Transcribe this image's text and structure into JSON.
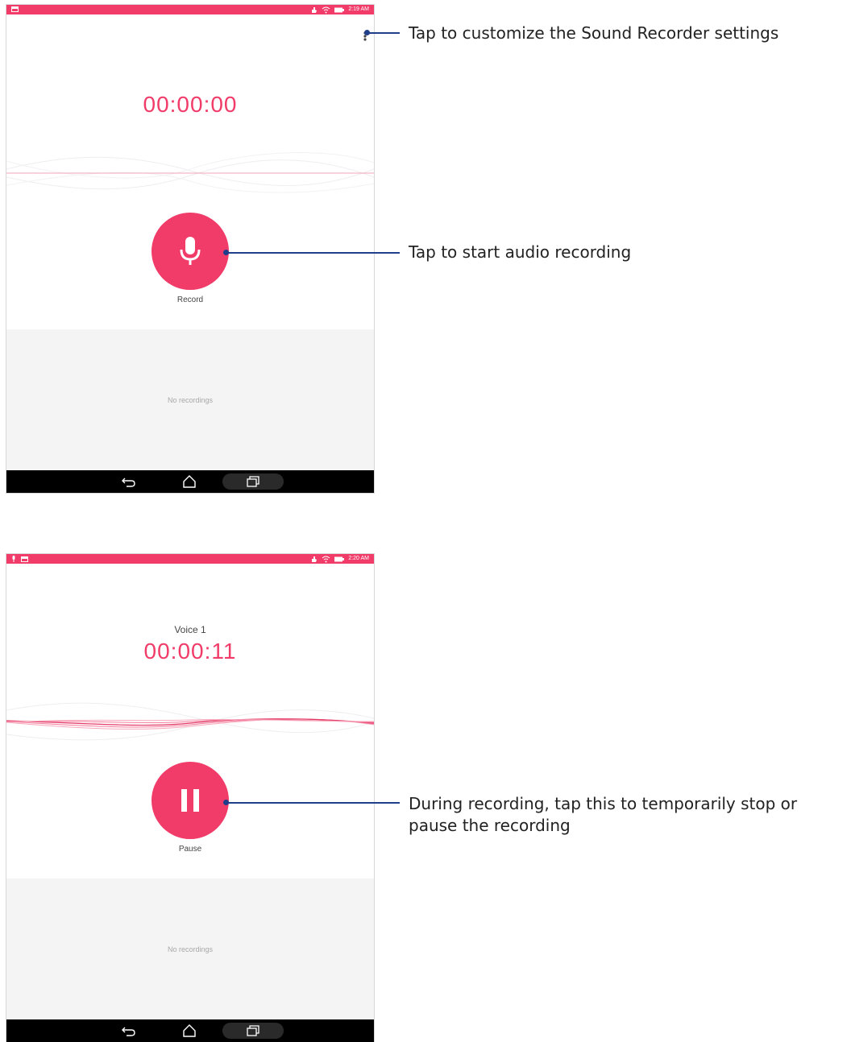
{
  "screen1": {
    "status_time": "2:19 AM",
    "timer": "00:00:00",
    "action_label": "Record",
    "empty_text": "No recordings"
  },
  "screen2": {
    "status_time": "2:20 AM",
    "recording_name": "Voice 1",
    "timer": "00:00:11",
    "action_label": "Pause",
    "empty_text": "No recordings"
  },
  "callouts": {
    "settings": "Tap to customize the Sound Recorder settings",
    "record": "Tap to start audio recording",
    "pause": "During recording, tap this to temporarily stop or pause the recording"
  },
  "icons": {
    "settings": "overflow-menu-icon",
    "record": "microphone-icon",
    "pause": "pause-icon",
    "back": "back-icon",
    "home": "home-icon",
    "recent": "recent-apps-icon"
  },
  "colors": {
    "accent": "#f13c6a",
    "callout": "#1f3f8a",
    "empty_area": "#f4f4f4",
    "navbar": "#000000"
  }
}
